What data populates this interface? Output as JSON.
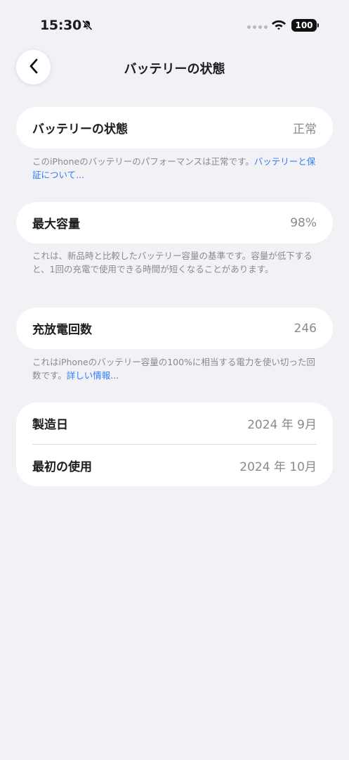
{
  "status_bar": {
    "time": "15:30",
    "battery_level": "100"
  },
  "nav": {
    "title": "バッテリーの状態"
  },
  "battery_health": {
    "label": "バッテリーの状態",
    "value": "正常",
    "note_text": "このiPhoneのバッテリーのパフォーマンスは正常です。",
    "note_link": "バッテリーと保証について..."
  },
  "max_capacity": {
    "label": "最大容量",
    "value": "98%",
    "note_text": "これは、新品時と比較したバッテリー容量の基準です。容量が低下すると、1回の充電で使用できる時間が短くなることがあります。"
  },
  "cycle_count": {
    "label": "充放電回数",
    "value": "246",
    "note_text": "これはiPhoneのバッテリー容量の100%に相当する電力を使い切った回数です。",
    "note_link": "詳しい情報..."
  },
  "dates": {
    "manufacture_label": "製造日",
    "manufacture_value": "2024 年 9月",
    "first_use_label": "最初の使用",
    "first_use_value": "2024 年 10月"
  }
}
